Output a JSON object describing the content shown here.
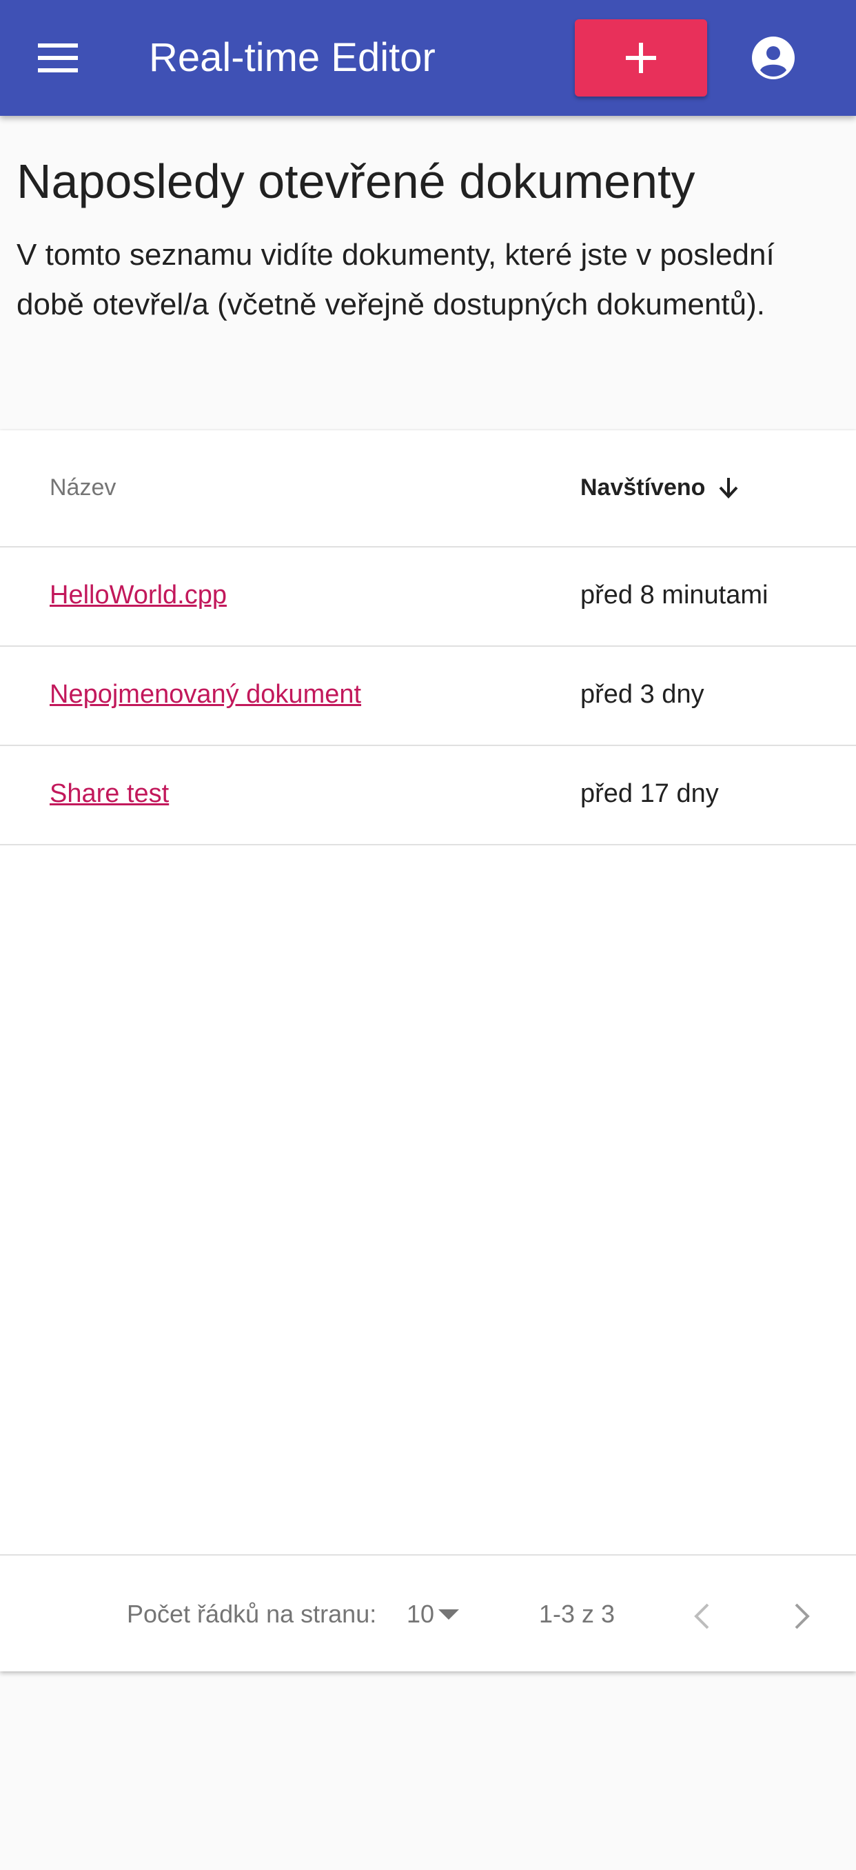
{
  "appbar": {
    "title": "Real-time Editor",
    "background": "#3f51b5",
    "menu_icon": "menu-icon",
    "add_icon": "plus-icon",
    "add_button_color": "#e8305a",
    "account_icon": "account-circle-icon"
  },
  "page": {
    "title": "Naposledy otevřené dokumenty",
    "description": "V tomto seznamu vidíte dokumenty, které jste v poslední době otevřel/a (včetně veřejně dostupných dokumentů)."
  },
  "table": {
    "columns": {
      "name": "Název",
      "visited": "Navštíveno"
    },
    "sort_icon": "arrow-down-icon",
    "link_color": "#c2185b",
    "rows": [
      {
        "name": "HelloWorld.cpp",
        "visited": "před 8 minutami"
      },
      {
        "name": "Nepojmenovaný dokument",
        "visited": "před 3 dny"
      },
      {
        "name": "Share test",
        "visited": "před 17 dny"
      }
    ]
  },
  "pagination": {
    "rows_per_page_label": "Počet řádků na stranu:",
    "rows_per_page_value": "10",
    "range": "1-3 z 3",
    "prev_icon": "chevron-left-icon",
    "next_icon": "chevron-right-icon"
  }
}
